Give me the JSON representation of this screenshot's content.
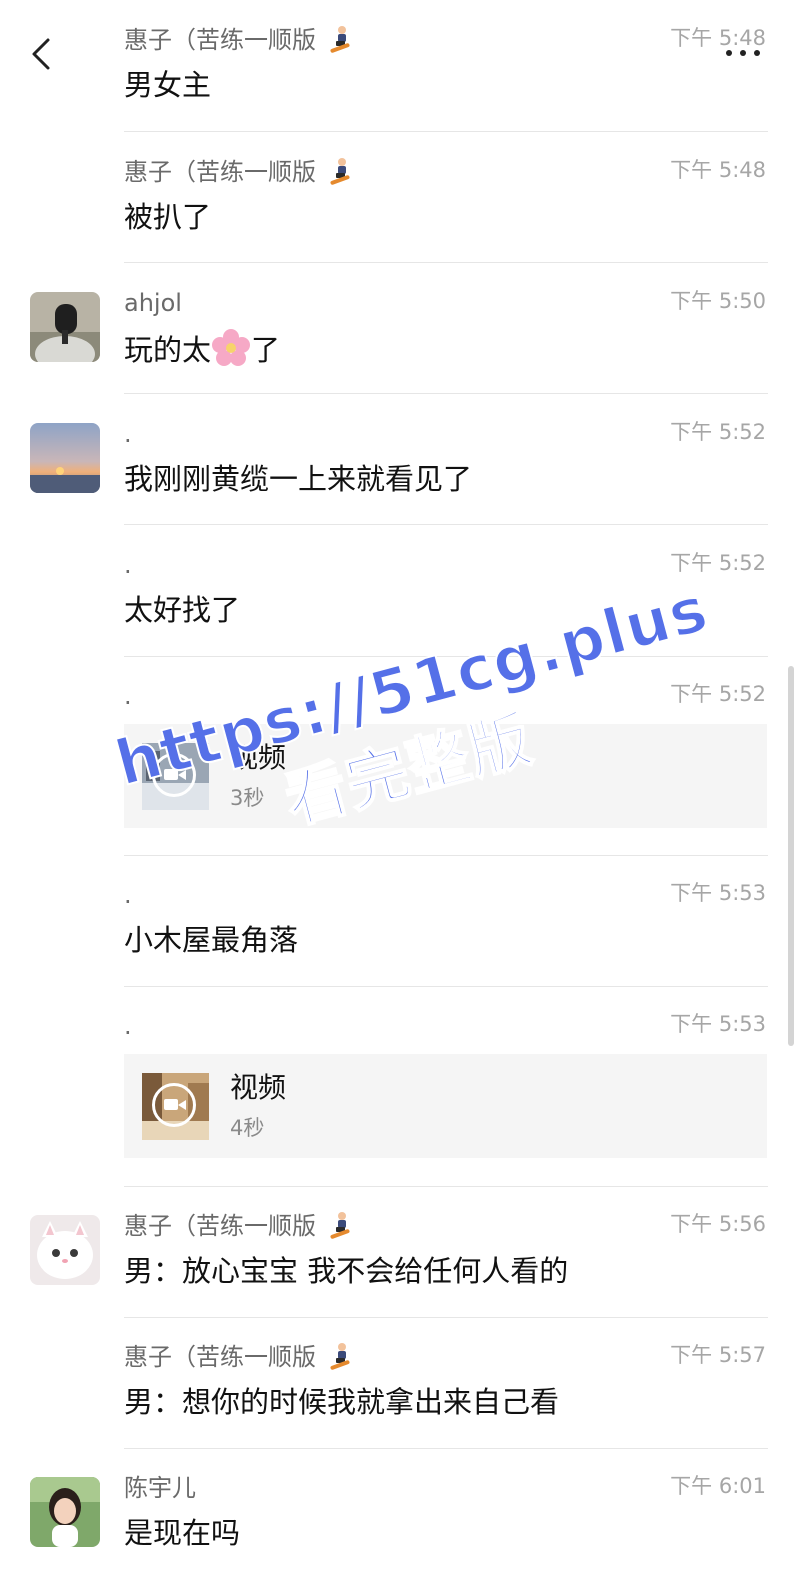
{
  "header": {
    "back_icon": "chevron-left-icon",
    "more_icon": "more-dots-icon"
  },
  "messages": [
    {
      "sender": "惠子（苦练一顺版",
      "sender_emoji": "snowboarder-emoji",
      "time": "下午 5:48",
      "text": "男女主"
    },
    {
      "sender": "惠子（苦练一顺版",
      "sender_emoji": "snowboarder-emoji",
      "time": "下午 5:48",
      "text": "被扒了"
    },
    {
      "sender": "ahjol",
      "time": "下午 5:50",
      "text_before": "玩的太",
      "text_emoji": "cherry-blossom-emoji",
      "text_after": "了"
    },
    {
      "sender": ".",
      "time": "下午 5:52",
      "text": "我刚刚黄缆一上来就看见了"
    },
    {
      "sender": ".",
      "time": "下午 5:52",
      "text": "太好找了"
    },
    {
      "sender": ".",
      "time": "下午 5:52",
      "video_title": "视频",
      "video_duration": "3秒"
    },
    {
      "sender": ".",
      "time": "下午 5:53",
      "text": "小木屋最角落"
    },
    {
      "sender": ".",
      "time": "下午 5:53",
      "video_title": "视频",
      "video_duration": "4秒"
    },
    {
      "sender": "惠子（苦练一顺版",
      "sender_emoji": "snowboarder-emoji",
      "time": "下午 5:56",
      "text": "男：放心宝宝 我不会给任何人看的"
    },
    {
      "sender": "惠子（苦练一顺版",
      "sender_emoji": "snowboarder-emoji",
      "time": "下午 5:57",
      "text": "男：想你的时候我就拿出来自己看"
    },
    {
      "sender": "陈宇儿",
      "time": "下午 6:01",
      "text": "是现在吗"
    }
  ],
  "watermark": {
    "line1": "https://51cg.plus",
    "line2": "看完整版"
  },
  "colors": {
    "watermark": "#5570e8",
    "sender": "#6a6a6a",
    "time": "#a6a6a6",
    "divider": "#e6e6e6",
    "video_card_bg": "#f5f5f5"
  }
}
